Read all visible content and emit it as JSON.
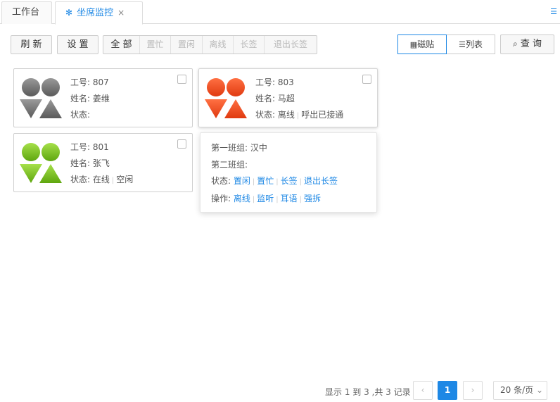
{
  "tabs": {
    "work": "工作台",
    "monitor": "坐席监控",
    "monitor_icon": "snowflake-icon",
    "close": "×",
    "menu": "☰"
  },
  "toolbar": {
    "refresh": "刷 新",
    "settings": "设 置",
    "filters": [
      {
        "label": "全 部",
        "active": true
      },
      {
        "label": "置忙",
        "active": false
      },
      {
        "label": "置闲",
        "active": false
      },
      {
        "label": "离线",
        "active": false
      },
      {
        "label": "长签",
        "active": false
      },
      {
        "label": "退出长签",
        "active": false
      }
    ],
    "view_magnet": "磁贴",
    "view_list": "列表",
    "query": "查 询"
  },
  "agents": [
    {
      "id_label": "工号: 807",
      "name_label": "姓名: 姜维",
      "status_label": "状态:",
      "status_parts": [],
      "color": "gray"
    },
    {
      "id_label": "工号: 803",
      "name_label": "姓名: 马超",
      "status_label": "状态:",
      "status_parts": [
        "离线",
        "呼出已接通"
      ],
      "color": "red"
    },
    {
      "id_label": "工号: 801",
      "name_label": "姓名: 张飞",
      "status_label": "状态:",
      "status_parts": [
        "在线",
        "空闲"
      ],
      "color": "green"
    }
  ],
  "popover": {
    "group1": "第一班组: 汉中",
    "group2": "第二班组:",
    "status_label": "状态:",
    "status_links": [
      "置闲",
      "置忙",
      "长签",
      "退出长签"
    ],
    "ops_label": "操作:",
    "ops_links": [
      "离线",
      "监听",
      "耳语",
      "强拆"
    ]
  },
  "pagination": {
    "info": "显示 1 到 3 ,共 3 记录",
    "prev": "‹",
    "current": "1",
    "next": "›",
    "page_size": "20 条/页",
    "page_size_caret": "⌄"
  },
  "colors": {
    "accent": "#1e88e5",
    "gray": "#6f6f6f",
    "red": "#f4511e",
    "green": "#7cc21b"
  }
}
